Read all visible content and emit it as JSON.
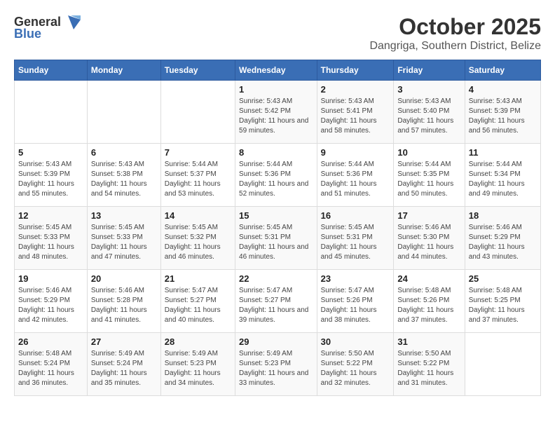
{
  "logo": {
    "general": "General",
    "blue": "Blue"
  },
  "title": {
    "month": "October 2025",
    "location": "Dangriga, Southern District, Belize"
  },
  "headers": [
    "Sunday",
    "Monday",
    "Tuesday",
    "Wednesday",
    "Thursday",
    "Friday",
    "Saturday"
  ],
  "weeks": [
    [
      {
        "day": "",
        "sunrise": "",
        "sunset": "",
        "daylight": ""
      },
      {
        "day": "",
        "sunrise": "",
        "sunset": "",
        "daylight": ""
      },
      {
        "day": "",
        "sunrise": "",
        "sunset": "",
        "daylight": ""
      },
      {
        "day": "1",
        "sunrise": "Sunrise: 5:43 AM",
        "sunset": "Sunset: 5:42 PM",
        "daylight": "Daylight: 11 hours and 59 minutes."
      },
      {
        "day": "2",
        "sunrise": "Sunrise: 5:43 AM",
        "sunset": "Sunset: 5:41 PM",
        "daylight": "Daylight: 11 hours and 58 minutes."
      },
      {
        "day": "3",
        "sunrise": "Sunrise: 5:43 AM",
        "sunset": "Sunset: 5:40 PM",
        "daylight": "Daylight: 11 hours and 57 minutes."
      },
      {
        "day": "4",
        "sunrise": "Sunrise: 5:43 AM",
        "sunset": "Sunset: 5:39 PM",
        "daylight": "Daylight: 11 hours and 56 minutes."
      }
    ],
    [
      {
        "day": "5",
        "sunrise": "Sunrise: 5:43 AM",
        "sunset": "Sunset: 5:39 PM",
        "daylight": "Daylight: 11 hours and 55 minutes."
      },
      {
        "day": "6",
        "sunrise": "Sunrise: 5:43 AM",
        "sunset": "Sunset: 5:38 PM",
        "daylight": "Daylight: 11 hours and 54 minutes."
      },
      {
        "day": "7",
        "sunrise": "Sunrise: 5:44 AM",
        "sunset": "Sunset: 5:37 PM",
        "daylight": "Daylight: 11 hours and 53 minutes."
      },
      {
        "day": "8",
        "sunrise": "Sunrise: 5:44 AM",
        "sunset": "Sunset: 5:36 PM",
        "daylight": "Daylight: 11 hours and 52 minutes."
      },
      {
        "day": "9",
        "sunrise": "Sunrise: 5:44 AM",
        "sunset": "Sunset: 5:36 PM",
        "daylight": "Daylight: 11 hours and 51 minutes."
      },
      {
        "day": "10",
        "sunrise": "Sunrise: 5:44 AM",
        "sunset": "Sunset: 5:35 PM",
        "daylight": "Daylight: 11 hours and 50 minutes."
      },
      {
        "day": "11",
        "sunrise": "Sunrise: 5:44 AM",
        "sunset": "Sunset: 5:34 PM",
        "daylight": "Daylight: 11 hours and 49 minutes."
      }
    ],
    [
      {
        "day": "12",
        "sunrise": "Sunrise: 5:45 AM",
        "sunset": "Sunset: 5:33 PM",
        "daylight": "Daylight: 11 hours and 48 minutes."
      },
      {
        "day": "13",
        "sunrise": "Sunrise: 5:45 AM",
        "sunset": "Sunset: 5:33 PM",
        "daylight": "Daylight: 11 hours and 47 minutes."
      },
      {
        "day": "14",
        "sunrise": "Sunrise: 5:45 AM",
        "sunset": "Sunset: 5:32 PM",
        "daylight": "Daylight: 11 hours and 46 minutes."
      },
      {
        "day": "15",
        "sunrise": "Sunrise: 5:45 AM",
        "sunset": "Sunset: 5:31 PM",
        "daylight": "Daylight: 11 hours and 46 minutes."
      },
      {
        "day": "16",
        "sunrise": "Sunrise: 5:45 AM",
        "sunset": "Sunset: 5:31 PM",
        "daylight": "Daylight: 11 hours and 45 minutes."
      },
      {
        "day": "17",
        "sunrise": "Sunrise: 5:46 AM",
        "sunset": "Sunset: 5:30 PM",
        "daylight": "Daylight: 11 hours and 44 minutes."
      },
      {
        "day": "18",
        "sunrise": "Sunrise: 5:46 AM",
        "sunset": "Sunset: 5:29 PM",
        "daylight": "Daylight: 11 hours and 43 minutes."
      }
    ],
    [
      {
        "day": "19",
        "sunrise": "Sunrise: 5:46 AM",
        "sunset": "Sunset: 5:29 PM",
        "daylight": "Daylight: 11 hours and 42 minutes."
      },
      {
        "day": "20",
        "sunrise": "Sunrise: 5:46 AM",
        "sunset": "Sunset: 5:28 PM",
        "daylight": "Daylight: 11 hours and 41 minutes."
      },
      {
        "day": "21",
        "sunrise": "Sunrise: 5:47 AM",
        "sunset": "Sunset: 5:27 PM",
        "daylight": "Daylight: 11 hours and 40 minutes."
      },
      {
        "day": "22",
        "sunrise": "Sunrise: 5:47 AM",
        "sunset": "Sunset: 5:27 PM",
        "daylight": "Daylight: 11 hours and 39 minutes."
      },
      {
        "day": "23",
        "sunrise": "Sunrise: 5:47 AM",
        "sunset": "Sunset: 5:26 PM",
        "daylight": "Daylight: 11 hours and 38 minutes."
      },
      {
        "day": "24",
        "sunrise": "Sunrise: 5:48 AM",
        "sunset": "Sunset: 5:26 PM",
        "daylight": "Daylight: 11 hours and 37 minutes."
      },
      {
        "day": "25",
        "sunrise": "Sunrise: 5:48 AM",
        "sunset": "Sunset: 5:25 PM",
        "daylight": "Daylight: 11 hours and 37 minutes."
      }
    ],
    [
      {
        "day": "26",
        "sunrise": "Sunrise: 5:48 AM",
        "sunset": "Sunset: 5:24 PM",
        "daylight": "Daylight: 11 hours and 36 minutes."
      },
      {
        "day": "27",
        "sunrise": "Sunrise: 5:49 AM",
        "sunset": "Sunset: 5:24 PM",
        "daylight": "Daylight: 11 hours and 35 minutes."
      },
      {
        "day": "28",
        "sunrise": "Sunrise: 5:49 AM",
        "sunset": "Sunset: 5:23 PM",
        "daylight": "Daylight: 11 hours and 34 minutes."
      },
      {
        "day": "29",
        "sunrise": "Sunrise: 5:49 AM",
        "sunset": "Sunset: 5:23 PM",
        "daylight": "Daylight: 11 hours and 33 minutes."
      },
      {
        "day": "30",
        "sunrise": "Sunrise: 5:50 AM",
        "sunset": "Sunset: 5:22 PM",
        "daylight": "Daylight: 11 hours and 32 minutes."
      },
      {
        "day": "31",
        "sunrise": "Sunrise: 5:50 AM",
        "sunset": "Sunset: 5:22 PM",
        "daylight": "Daylight: 11 hours and 31 minutes."
      },
      {
        "day": "",
        "sunrise": "",
        "sunset": "",
        "daylight": ""
      }
    ]
  ]
}
